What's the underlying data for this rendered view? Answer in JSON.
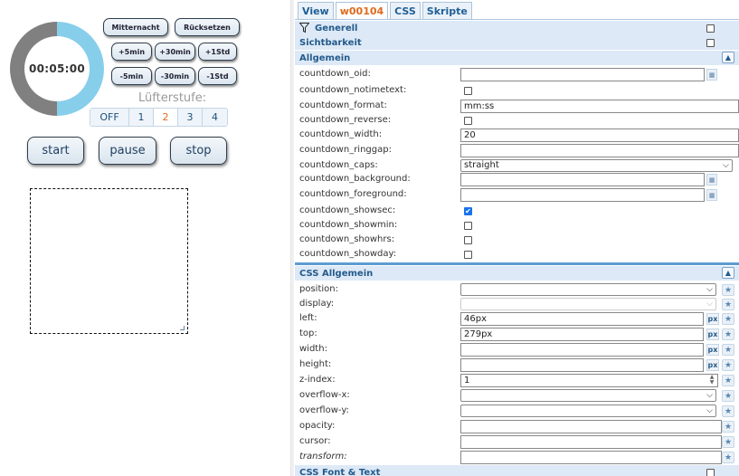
{
  "countdown": {
    "time": "00:05:00",
    "progress_fraction": 0.5,
    "color_fg": "#87ceeb",
    "color_bg": "#808080"
  },
  "buttons": {
    "mitternacht": "Mitternacht",
    "ruecksetzen": "Rücksetzen",
    "plus5": "+5min",
    "plus30": "+30min",
    "plus1std": "+1Std",
    "minus5": "-5min",
    "minus30": "-30min",
    "minus1std": "-1Std",
    "start": "start",
    "pause": "pause",
    "stop": "stop"
  },
  "fan": {
    "label": "Lüfterstufe:",
    "options": [
      "OFF",
      "1",
      "2",
      "3",
      "4"
    ],
    "active": "2"
  },
  "tabs": [
    "View",
    "w00104",
    "CSS",
    "Skripte"
  ],
  "active_tab": "w00104",
  "sections": {
    "generell": "Generell",
    "sichtbarkeit": "Sichtbarkeit",
    "allgemein": "Allgemein",
    "css_allgemein": "CSS Allgemein",
    "css_font": "CSS Font & Text"
  },
  "props": [
    {
      "key": "countdown_oid:",
      "type": "text-pick",
      "value": ""
    },
    {
      "key": "countdown_notimetext:",
      "type": "check",
      "value": false
    },
    {
      "key": "countdown_format:",
      "type": "text",
      "value": "mm:ss"
    },
    {
      "key": "countdown_reverse:",
      "type": "check",
      "value": false
    },
    {
      "key": "countdown_width:",
      "type": "text",
      "value": "20"
    },
    {
      "key": "countdown_ringgap:",
      "type": "text",
      "value": ""
    },
    {
      "key": "countdown_caps:",
      "type": "select",
      "value": "straight"
    },
    {
      "key": "countdown_background:",
      "type": "text-pick",
      "value": ""
    },
    {
      "key": "countdown_foreground:",
      "type": "text-pick",
      "value": ""
    },
    {
      "key": "countdown_showsec:",
      "type": "check",
      "value": true
    },
    {
      "key": "countdown_showmin:",
      "type": "check",
      "value": false
    },
    {
      "key": "countdown_showhrs:",
      "type": "check",
      "value": false
    },
    {
      "key": "countdown_showday:",
      "type": "check",
      "value": false
    }
  ],
  "css_props": [
    {
      "key": "position:",
      "type": "select",
      "value": ""
    },
    {
      "key": "display:",
      "type": "select-disabled",
      "value": ""
    },
    {
      "key": "left:",
      "type": "px",
      "value": "46px"
    },
    {
      "key": "top:",
      "type": "px",
      "value": "279px"
    },
    {
      "key": "width:",
      "type": "px",
      "value": ""
    },
    {
      "key": "height:",
      "type": "px",
      "value": ""
    },
    {
      "key": "z-index:",
      "type": "spin",
      "value": "1"
    },
    {
      "key": "overflow-x:",
      "type": "select",
      "value": ""
    },
    {
      "key": "overflow-y:",
      "type": "select",
      "value": ""
    },
    {
      "key": "opacity:",
      "type": "text",
      "value": ""
    },
    {
      "key": "cursor:",
      "type": "text",
      "value": ""
    },
    {
      "key": "transform:",
      "type": "text-italic",
      "value": ""
    }
  ],
  "icons": {
    "filter": "filter-icon",
    "color_picker": "color-picker-icon",
    "star": "star-icon",
    "collapse": "chevron-up-icon",
    "dropdown": "chevron-down-icon"
  }
}
